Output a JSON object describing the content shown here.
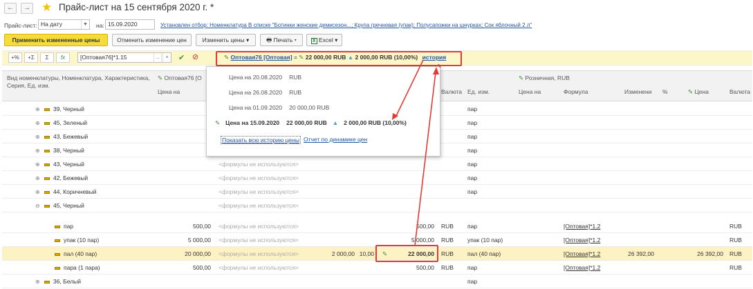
{
  "title": "Прайс-лист на 15 сентября 2020 г. *",
  "filters": {
    "pricelist_label": "Прайс-лист:",
    "pricelist_value": "На дату",
    "on_label": "на:",
    "date_value": "15.09.2020",
    "filter_link": "Установлен отбор: Номенклатура В списке \"Ботинки женские демисезон...; Крупа гречневая (упак); Полусапожки на шнурках; Сок яблочный 2 л\""
  },
  "toolbar": {
    "apply": "Применить измененные цены",
    "cancel": "Отменить изменение цен",
    "change": "Изменить цены",
    "print": "Печать",
    "excel": "Excel"
  },
  "formula_bar": {
    "b1": "+%",
    "b2": "+Σ",
    "b3": "Σ",
    "b4": "fx",
    "formula": "[Оптовая76]*1.15",
    "summary_link": "Оптовая76 [Оптовая]",
    "summary_eq": "=",
    "summary_value": "22 000,00 RUB",
    "summary_delta": "2 000,00 RUB (10,00%)",
    "history_link": "история"
  },
  "header": {
    "col1": "Вид номенклатуры, Номенклатура, Характеристика, Серия, Ед. изм.",
    "group1": "Оптовая76 [О",
    "price_on": "Цена на",
    "currency": "Валюта",
    "unit": "Ед. изм.",
    "group2": "Розничная, RUB",
    "price_on2": "Цена на",
    "formula": "Формула",
    "changed": "Изменени",
    "pct": "%",
    "price": "Цена",
    "currency2": "Валюта"
  },
  "history_popup": {
    "rows": [
      {
        "label": "Цена на 20.08.2020",
        "value": "RUB"
      },
      {
        "label": "Цена на 26.08.2020",
        "value": "RUB"
      },
      {
        "label": "Цена на 01.09.2020",
        "value": "20 000,00 RUB"
      }
    ],
    "current_label": "Цена на 15.09.2020",
    "current_value": "22 000,00 RUB",
    "current_delta": "2 000,00 RUB (10,00%)",
    "link_all": "Показать всю историю цены",
    "link_report": "Отчет по динамике цен"
  },
  "no_formulas": "<формулы не используются>",
  "rows": [
    {
      "name": "39, Черный",
      "unit": "пар"
    },
    {
      "name": "45, Зеленый",
      "unit": "пар"
    },
    {
      "name": "43, Бежевый",
      "unit": "пар"
    },
    {
      "name": "38, Черный",
      "unit": "пар"
    },
    {
      "name": "43, Черный",
      "unit": "пар"
    },
    {
      "name": "42, Бежевый",
      "unit": "пар"
    },
    {
      "name": "44, Коричневый",
      "unit": "пар"
    },
    {
      "name": "45, Черный",
      "unit": ""
    }
  ],
  "detail_rows": [
    {
      "name": "пар",
      "price": "500,00",
      "val": "500,00",
      "cur": "RUB",
      "unit": "пар",
      "formula": "[Оптовая]*1.2",
      "cur2": "RUB"
    },
    {
      "name": "упак (10 пар)",
      "price": "5 000,00",
      "val": "5 000,00",
      "cur": "RUB",
      "unit": "упак (10 пар)",
      "formula": "[Оптовая]*1.2",
      "cur2": "RUB"
    },
    {
      "name": "пал (40 пар)",
      "price": "20 000,00",
      "d1": "2 000,00",
      "d2": "10,00",
      "val": "22 000,00",
      "cur": "RUB",
      "unit": "пал (40 пар)",
      "formula": "[Оптовая]*1.2",
      "changed": "26 392,00",
      "price2": "26 392,00",
      "cur2": "RUB"
    },
    {
      "name": "пара (1 пара)",
      "price": "500,00",
      "val": "500,00",
      "cur": "RUB",
      "unit": "пар",
      "formula": "[Оптовая]*1.2",
      "cur2": "RUB"
    }
  ],
  "last_row": {
    "name": "36, Белый",
    "unit": "пар"
  },
  "colors": {
    "accent": "#f5dc3c",
    "link": "#2156a5",
    "highlight": "#e53935",
    "selected_row": "#fdf2c4"
  }
}
